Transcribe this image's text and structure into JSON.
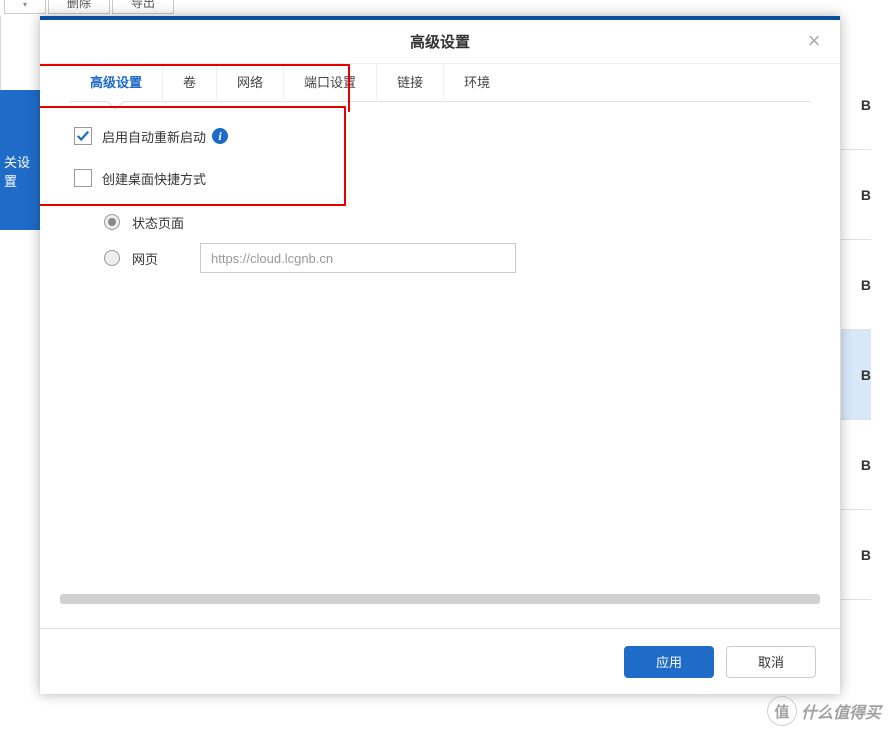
{
  "background": {
    "toolbar": {
      "dropdown_suffix": "",
      "delete": "删除",
      "export": "导出"
    },
    "sidebar": {
      "label": "关设置"
    },
    "right_markers": [
      "B",
      "B",
      "B",
      "B",
      "B",
      "B"
    ]
  },
  "modal": {
    "title": "高级设置",
    "tabs": {
      "advanced": "高级设置",
      "volume": "卷",
      "network": "网络",
      "port": "端口设置",
      "links": "链接",
      "env": "环境"
    },
    "checkbox_auto_restart": "启用自动重新启动",
    "checkbox_shortcut": "创建桌面快捷方式",
    "radio_status": "状态页面",
    "radio_web": "网页",
    "url_value": "https://cloud.lcgnb.cn",
    "apply": "应用",
    "cancel": "取消"
  },
  "watermark": {
    "badge": "值",
    "text": "什么值得买"
  }
}
